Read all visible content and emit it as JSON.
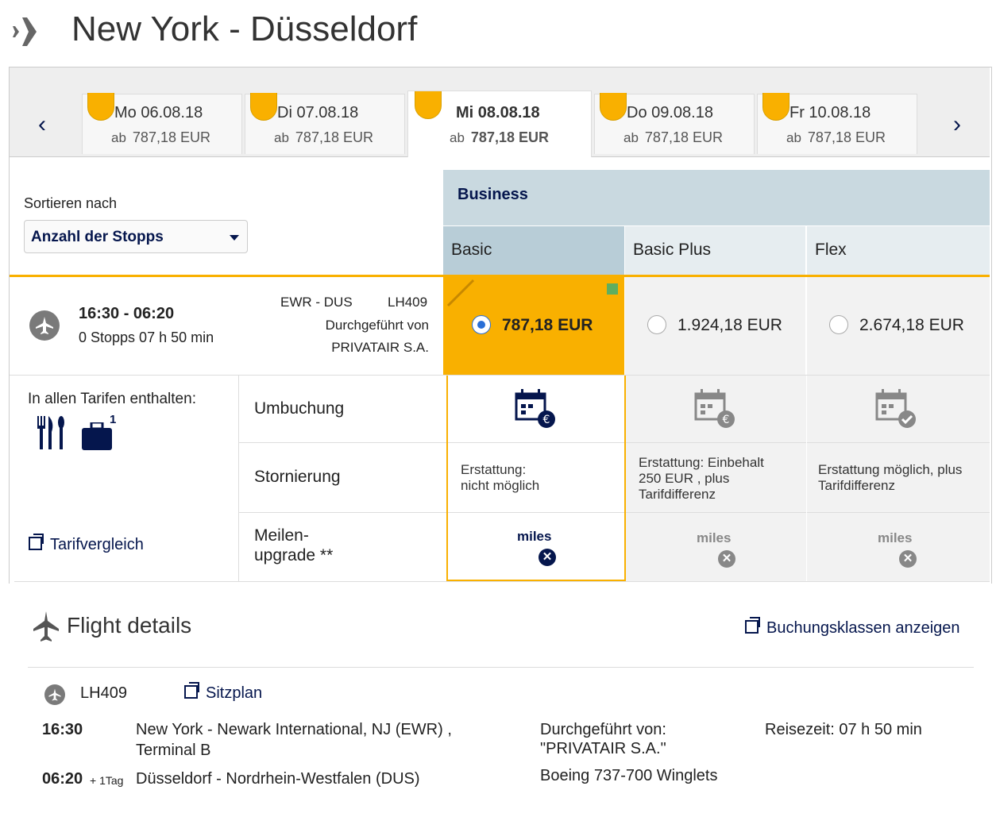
{
  "header": {
    "title": "New York - Düsseldorf"
  },
  "dates": {
    "prev": "‹",
    "next": "›",
    "tabs": [
      {
        "date": "Mo 06.08.18",
        "ab": "ab",
        "price": "787,18 EUR"
      },
      {
        "date": "Di 07.08.18",
        "ab": "ab",
        "price": "787,18 EUR"
      },
      {
        "date": "Mi 08.08.18",
        "ab": "ab",
        "price": "787,18 EUR"
      },
      {
        "date": "Do 09.08.18",
        "ab": "ab",
        "price": "787,18 EUR"
      },
      {
        "date": "Fr 10.08.18",
        "ab": "ab",
        "price": "787,18 EUR"
      }
    ]
  },
  "sort": {
    "label": "Sortieren nach",
    "value": "Anzahl der Stopps"
  },
  "cabin": {
    "name": "Business"
  },
  "fares": [
    "Basic",
    "Basic Plus",
    "Flex"
  ],
  "flight": {
    "times": "16:30 - 06:20",
    "stops": "0 Stopps 07 h 50 min",
    "route": "EWR - DUS",
    "number": "LH409",
    "operated_label": "Durchgeführt von",
    "operator": "PRIVATAIR S.A.",
    "prices": [
      "787,18 EUR",
      "1.924,18 EUR",
      "2.674,18 EUR"
    ]
  },
  "included": {
    "label": "In allen Tarifen enthalten:",
    "baggage_count": "1"
  },
  "compare_link": "Tarifvergleich",
  "rows": {
    "rebooking": "Umbuchung",
    "cancellation": "Stornierung",
    "miles_upgrade_1": "Meilen-",
    "miles_upgrade_2": "upgrade **"
  },
  "refunds": [
    [
      "Erstattung:",
      "nicht möglich"
    ],
    [
      "Erstattung: Einbehalt",
      "250 EUR , plus",
      "Tarifdifferenz"
    ],
    [
      "Erstattung möglich, plus",
      "Tarifdifferenz"
    ]
  ],
  "miles_label": "miles",
  "details": {
    "title": "Flight details",
    "booking_classes_link": "Buchungsklassen anzeigen",
    "flight_no": "LH409",
    "seatmap_link": "Sitzplan",
    "dep_time": "16:30",
    "dep_airport_1": "New York - Newark International, NJ (EWR) ,",
    "dep_airport_2": "Terminal B",
    "arr_time": "06:20",
    "arr_plus": "+ 1Tag",
    "arr_airport": "Düsseldorf - Nordrhein-Westfalen (DUS)",
    "operated_label": "Durchgeführt von:",
    "operator": "\"PRIVATAIR S.A.\"",
    "aircraft": "Boeing 737-700 Winglets",
    "travel_time": "Reisezeit: 07 h 50 min"
  },
  "colors": {
    "accent": "#f9b000",
    "navy": "#05164d",
    "cabin_bg": "#c9d9e0"
  }
}
